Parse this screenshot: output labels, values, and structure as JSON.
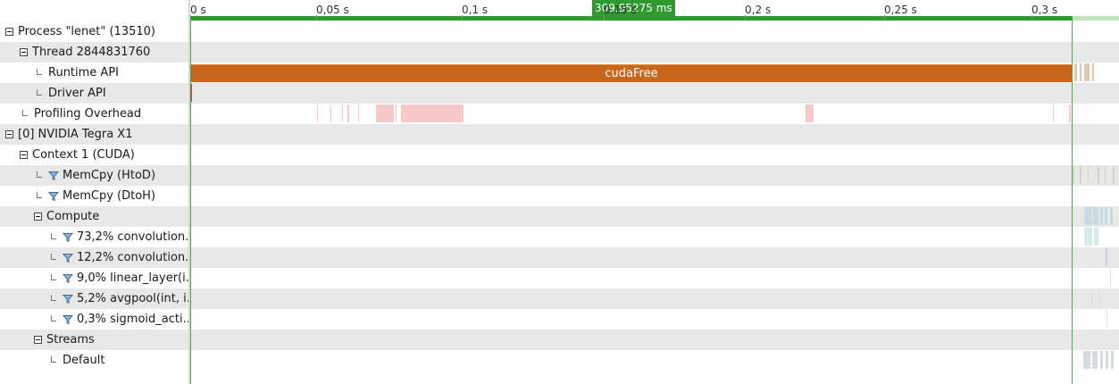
{
  "tree": [
    {
      "id": "process",
      "label": "Process \"lenet\" (13510)",
      "indent": 0,
      "kind": "toggle"
    },
    {
      "id": "thread",
      "label": "Thread 2844831760",
      "indent": 1,
      "kind": "toggle"
    },
    {
      "id": "runtime-api",
      "label": "Runtime API",
      "indent": 2,
      "kind": "leaf"
    },
    {
      "id": "driver-api",
      "label": "Driver API",
      "indent": 2,
      "kind": "leaf"
    },
    {
      "id": "profiling-overhead",
      "label": "Profiling Overhead",
      "indent": 1,
      "kind": "leaf"
    },
    {
      "id": "gpu",
      "label": "[0] NVIDIA Tegra X1",
      "indent": 0,
      "kind": "toggle"
    },
    {
      "id": "context",
      "label": "Context 1 (CUDA)",
      "indent": 1,
      "kind": "toggle"
    },
    {
      "id": "memcpy-htod",
      "label": "MemCpy (HtoD)",
      "indent": 2,
      "kind": "filter"
    },
    {
      "id": "memcpy-dtoh",
      "label": "MemCpy (DtoH)",
      "indent": 2,
      "kind": "filter"
    },
    {
      "id": "compute",
      "label": "Compute",
      "indent": 2,
      "kind": "toggle"
    },
    {
      "id": "kernel-1",
      "label": "73,2% convolution...",
      "indent": 3,
      "kind": "filter"
    },
    {
      "id": "kernel-2",
      "label": "12,2% convolution...",
      "indent": 3,
      "kind": "filter"
    },
    {
      "id": "kernel-3",
      "label": "9,0% linear_layer(i...",
      "indent": 3,
      "kind": "filter"
    },
    {
      "id": "kernel-4",
      "label": "5,2% avgpool(int, i...",
      "indent": 3,
      "kind": "filter"
    },
    {
      "id": "kernel-5",
      "label": "0,3% sigmoid_acti...",
      "indent": 3,
      "kind": "filter"
    },
    {
      "id": "streams",
      "label": "Streams",
      "indent": 2,
      "kind": "toggle"
    },
    {
      "id": "default-stream",
      "label": "Default",
      "indent": 3,
      "kind": "leaf"
    }
  ],
  "ruler": {
    "ticks": [
      "0 s",
      "0,05 s",
      "0,1 s",
      "0,15 s",
      "0,2 s",
      "0,25 s",
      "0,3 s"
    ],
    "selection_label": "309,95275 ms"
  },
  "timeline": {
    "cuda_free_label": "cudaFree",
    "colors": {
      "selection": "#2f9a2f",
      "runtime_api": "#c7661c",
      "overhead": "#f7c8c8"
    }
  }
}
